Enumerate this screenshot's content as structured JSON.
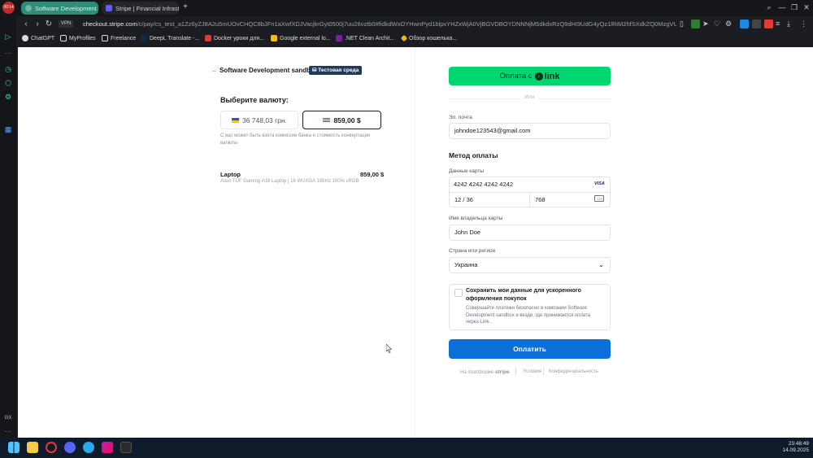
{
  "browser": {
    "clock_badge": "00:14",
    "tabs": [
      {
        "label": "Software Development sa",
        "active": true
      },
      {
        "label": "Stripe | Financial Infrastru",
        "active": false
      }
    ],
    "new_tab": "+",
    "vpn": "VPN",
    "url_host": "checkout.stripe.com",
    "url_rest": "/c/pay/cs_test_a1Zz6yZJ8A2u5mUOvCHQC8bJFn1aXwfXDJVacjkrGyt0500j7uu26vztb0#fidkdWxOYHwnPyd1blpxYHZxWjA0VjBGVDBOYDNNNjM5dkdxRzQ9dHI9UdG4yQz1lRiM2hfSXdkZQ0MzgVUJCbj1LN",
    "bookmarks": [
      "ChatGPT",
      "MyProfiles",
      "Freelance",
      "DeepL Translate -...",
      "Docker уроки для...",
      "Google external lo...",
      ".NET Clean Archit...",
      "Обзор кошелька..."
    ]
  },
  "checkout": {
    "back_arrow": "←",
    "merchant": "Software Development sandbox",
    "test_badge": "Тестовая среда",
    "currency_title": "Выберите валюту:",
    "currency_uah": "36 748,03 грн.",
    "currency_usd": "859,00 $",
    "currency_note": "С вас может быть взята комиссия банка и стоимость конвертации валюты",
    "product_name": "Laptop",
    "product_desc": "Asus TUF Gaming A16 Laptop | 16 WUXGA 165Hz 100% sRGB",
    "product_price": "859,00 $",
    "link_button_prefix": "Оплата с",
    "link_word": "link",
    "or_text": "Или",
    "email_label": "Эл. почта",
    "email_value": "johndoe123543@gmail.com",
    "payment_method_title": "Метод оплаты",
    "card_label": "Данные карты",
    "card_number": "4242 4242 4242 4242",
    "card_brand": "VISA",
    "card_expiry": "12 / 36",
    "card_cvc": "768",
    "cvc_icon_text": "123",
    "holder_label": "Имя владельца карты",
    "holder_value": "John Doe",
    "country_label": "Страна или регион",
    "country_value": "Украина",
    "save_title": "Сохранить мои данные для ускоренного оформления покупок",
    "save_desc": "Совершайте платежи безопасно в компании Software Development sandbox и везде, где принимается оплата через Link.",
    "pay_button": "Оплатить",
    "footer_powered": "На платформе",
    "footer_brand": "stripe",
    "footer_terms": "Условия",
    "footer_privacy": "Конфиденциальность"
  },
  "taskbar": {
    "time": "23:48:49",
    "date": "14.09.2025"
  },
  "colors": {
    "accent_link": "#00d66f",
    "pay_button": "#0a6fd6",
    "tab_active": "#2b8f78"
  }
}
